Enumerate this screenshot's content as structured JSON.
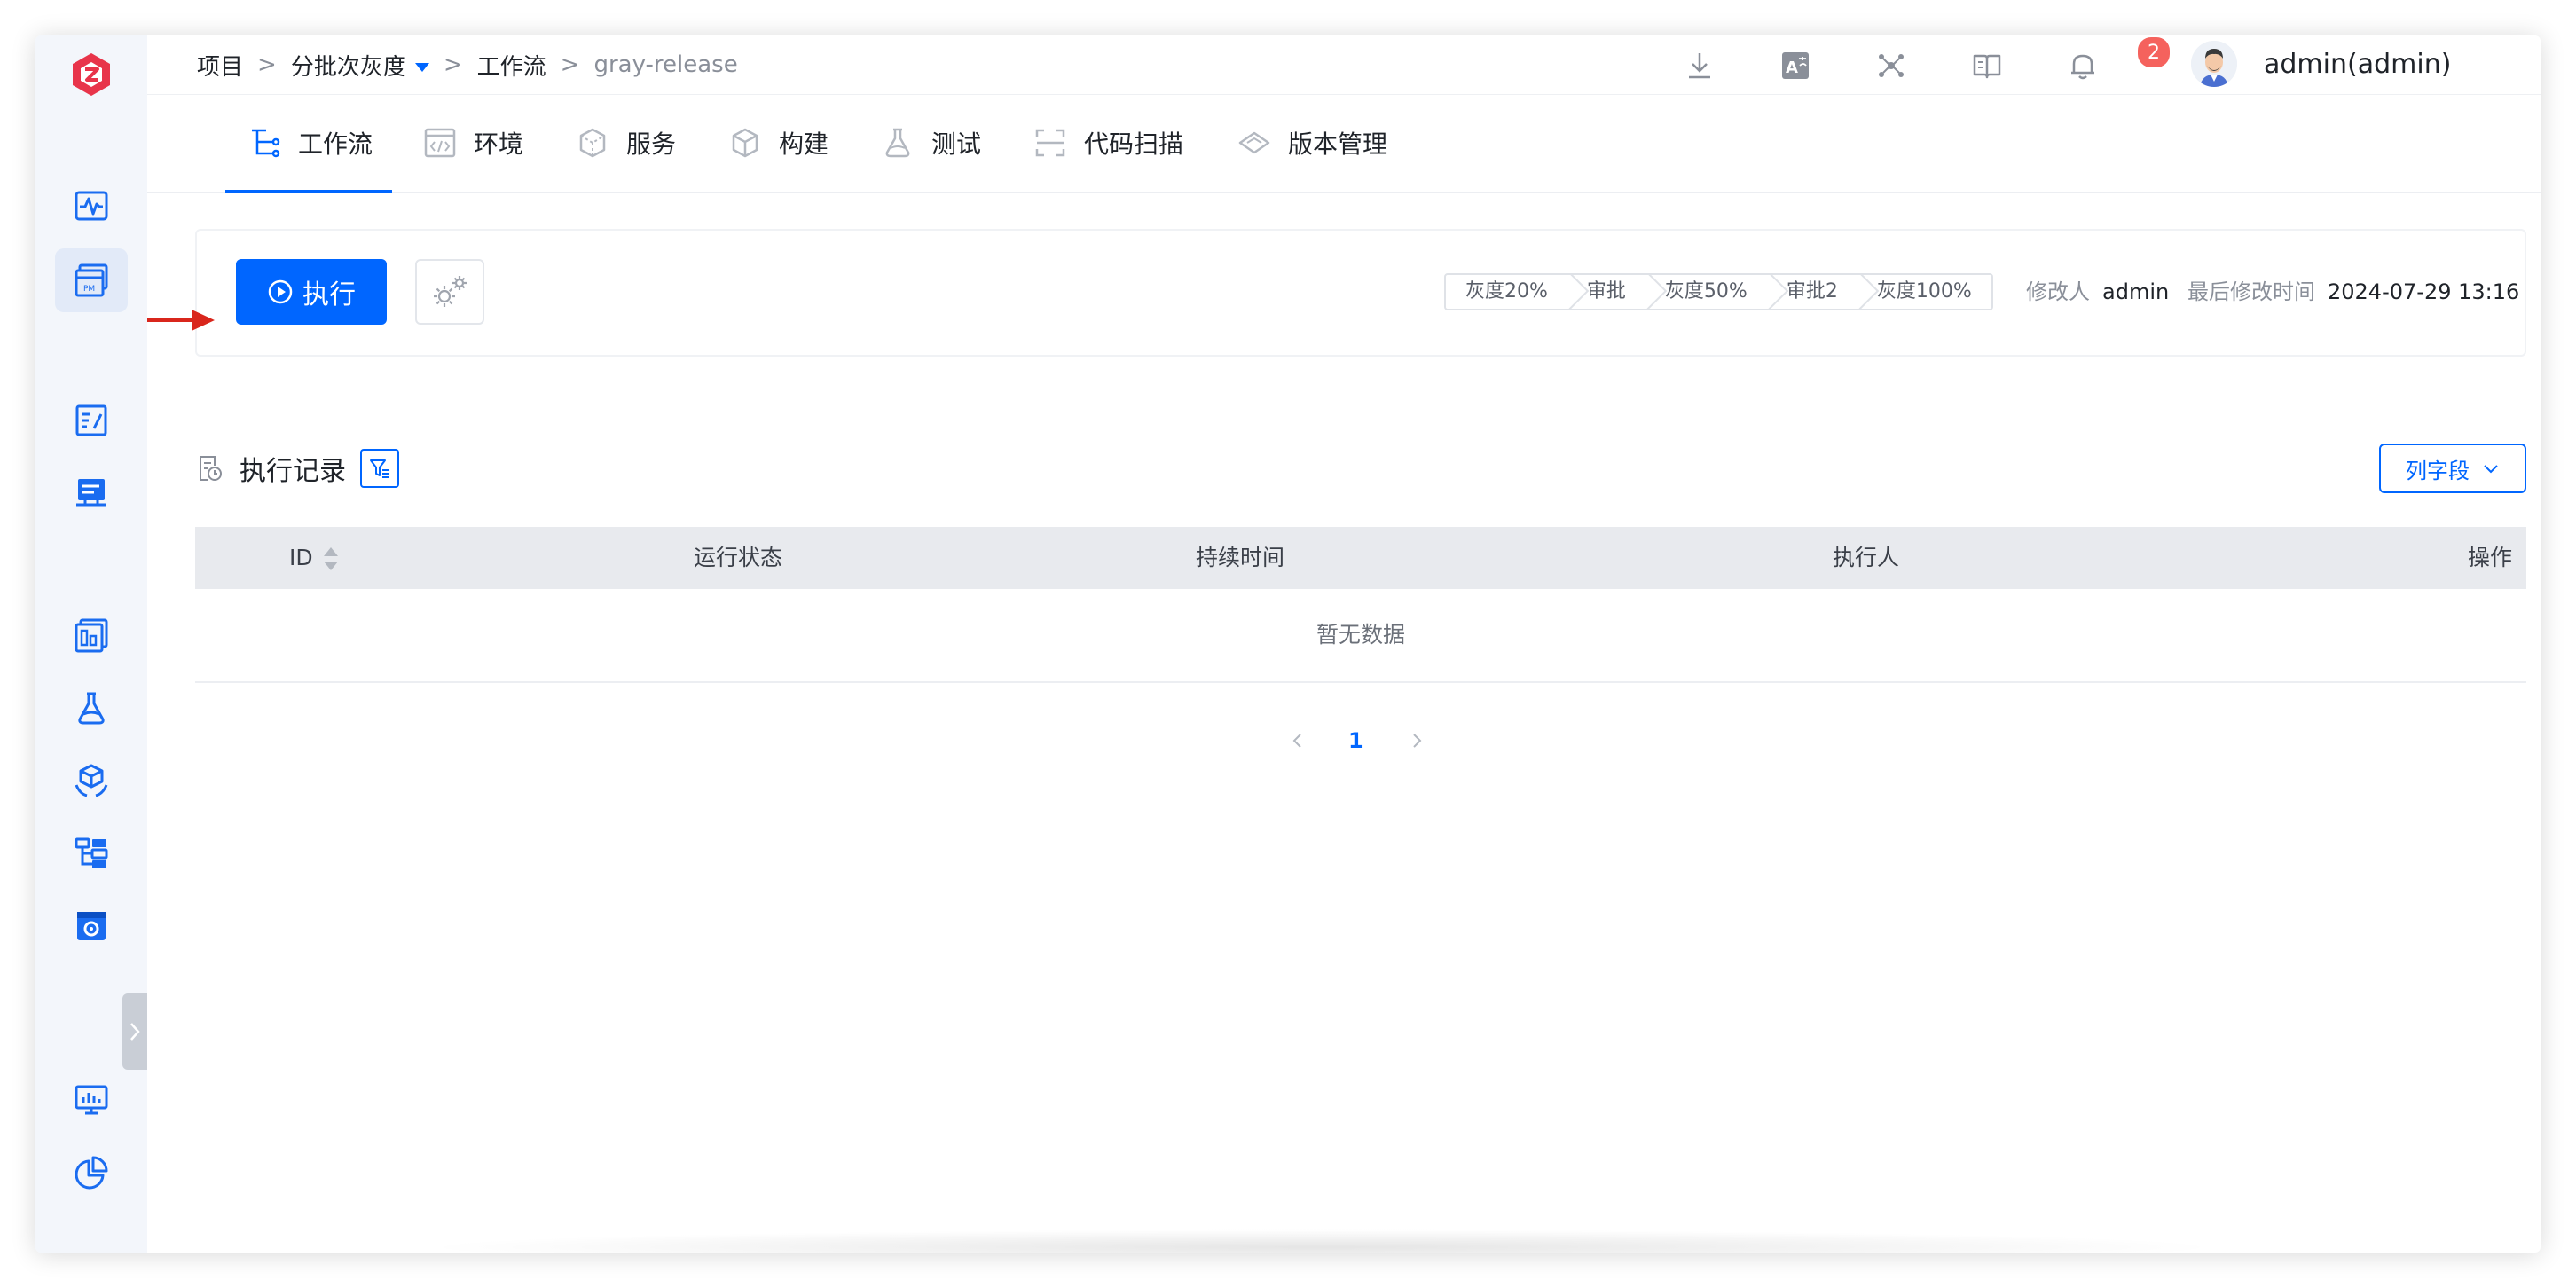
{
  "breadcrumb": {
    "project": "项目",
    "current_project": "分批次灰度",
    "section": "工作流",
    "workflow": "gray-release",
    "separator": ">"
  },
  "header": {
    "notification_count": "2",
    "user": "admin(admin)"
  },
  "tabs": [
    {
      "label": "工作流",
      "icon": "workflow-icon",
      "active": true
    },
    {
      "label": "环境",
      "icon": "environment-icon"
    },
    {
      "label": "服务",
      "icon": "service-icon"
    },
    {
      "label": "构建",
      "icon": "build-icon"
    },
    {
      "label": "测试",
      "icon": "test-flask-icon"
    },
    {
      "label": "代码扫描",
      "icon": "code-scan-icon"
    },
    {
      "label": "版本管理",
      "icon": "version-icon"
    }
  ],
  "toolbar": {
    "run_label": "执行",
    "stages": [
      "灰度20%",
      "审批",
      "灰度50%",
      "审批2",
      "灰度100%"
    ],
    "modifier_key": "修改人",
    "modifier_value": "admin",
    "modified_time_key": "最后修改时间",
    "modified_time_value": "2024-07-29 13:16"
  },
  "records": {
    "title": "执行记录",
    "columns_button": "列字段",
    "columns": [
      "ID",
      "运行状态",
      "持续时间",
      "执行人",
      "操作"
    ],
    "empty_text": "暂无数据"
  },
  "pagination": {
    "current_page": "1"
  },
  "colors": {
    "primary": "#0066ff",
    "badge": "#f5625d",
    "arrow": "#d9261c",
    "sidebar_bg": "#f3f6fb"
  }
}
